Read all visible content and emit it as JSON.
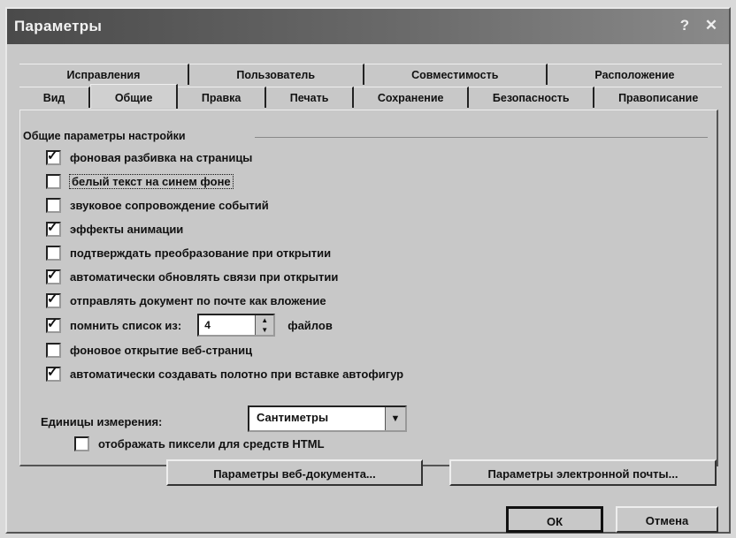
{
  "window": {
    "title": "Параметры",
    "help": "?",
    "close": "✕"
  },
  "tabs": {
    "back": [
      "Исправления",
      "Пользователь",
      "Совместимость",
      "Расположение"
    ],
    "front": [
      "Вид",
      "Общие",
      "Правка",
      "Печать",
      "Сохранение",
      "Безопасность",
      "Правописание"
    ],
    "active": "Общие"
  },
  "group_title": "Общие параметры настройки",
  "options": [
    {
      "label": "фоновая разбивка на страницы",
      "checked": true
    },
    {
      "label": "белый текст на синем фоне",
      "checked": false
    },
    {
      "label": "звуковое сопровождение событий",
      "checked": false
    },
    {
      "label": "эффекты анимации",
      "checked": true
    },
    {
      "label": "подтверждать преобразование при открытии",
      "checked": false
    },
    {
      "label": "автоматически обновлять связи при открытии",
      "checked": true
    },
    {
      "label": "отправлять документ по почте как вложение",
      "checked": true
    },
    {
      "label": "помнить список из:",
      "checked": true,
      "spin_value": "4",
      "suffix": "файлов"
    },
    {
      "label": "фоновое открытие веб-страниц",
      "checked": false
    },
    {
      "label": "автоматически создавать полотно при вставке автофигур",
      "checked": true
    }
  ],
  "units": {
    "label": "Единицы измерения:",
    "value": "Сантиметры"
  },
  "pixels_option": {
    "label": "отображать пиксели для средств HTML",
    "checked": false
  },
  "buttons": {
    "web_options": "Параметры веб-документа...",
    "email_options": "Параметры электронной почты...",
    "ok": "ОК",
    "cancel": "Отмена"
  }
}
